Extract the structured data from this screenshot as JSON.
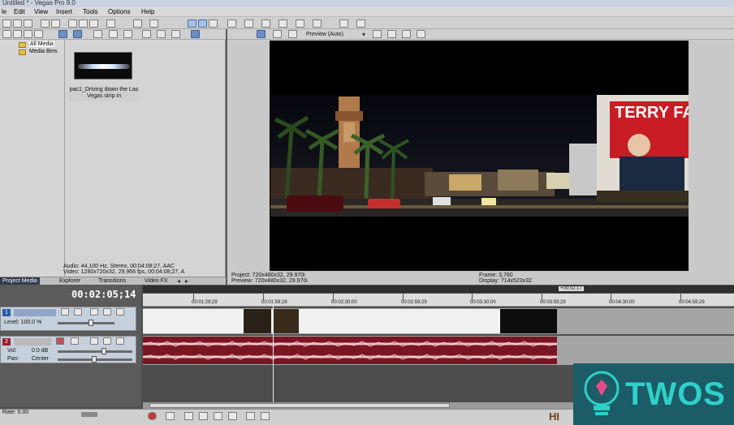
{
  "window": {
    "title": "Untitled * - Vegas Pro 9.0"
  },
  "menu": [
    "le",
    "Edit",
    "View",
    "Insert",
    "Tools",
    "Options",
    "Help"
  ],
  "media_panel": {
    "tree": [
      "All Media",
      "Media Bins"
    ],
    "clip_caption": "pac1_Driving down the Las Vegas strip in",
    "status_audio": "Audio: 44,100 Hz, Stereo, 00:04:08;27, AAC",
    "status_video": "Video: 1280x720x32, 29.966 fps, 00:04:08;27, A",
    "tabs": [
      "Project Media",
      "Explorer",
      "Transitions",
      "Video FX"
    ]
  },
  "preview": {
    "mode": "Preview (Auto)",
    "project": "Project:   720x480x32, 29.970i",
    "preview_line": "Preview:  720x480x32, 29.970i",
    "frame": "Frame:     3,760",
    "display": "Display:   714x523x32",
    "sign_text": "TERRY FATOR"
  },
  "timeline": {
    "timecode": "00:02:05;14",
    "loop_label": "+00:02:17",
    "video_track": {
      "number": "1",
      "level": "Level: 100.0 %"
    },
    "audio_track": {
      "number": "2",
      "vol_label": "Vol:",
      "vol_value": "0.0 dB",
      "pan_label": "Pan:",
      "pan_value": "Center"
    },
    "ruler": [
      "00:01:29;29",
      "00:01;59;28",
      "00:02:30;00",
      "00:02:59;29",
      "00:03:30;00",
      "00:03:59;29",
      "00:04:30;00",
      "00:04:59;29"
    ],
    "rate": "Rate: 0.00"
  },
  "watermark": {
    "text": "TWOS",
    "corner": "HI"
  }
}
